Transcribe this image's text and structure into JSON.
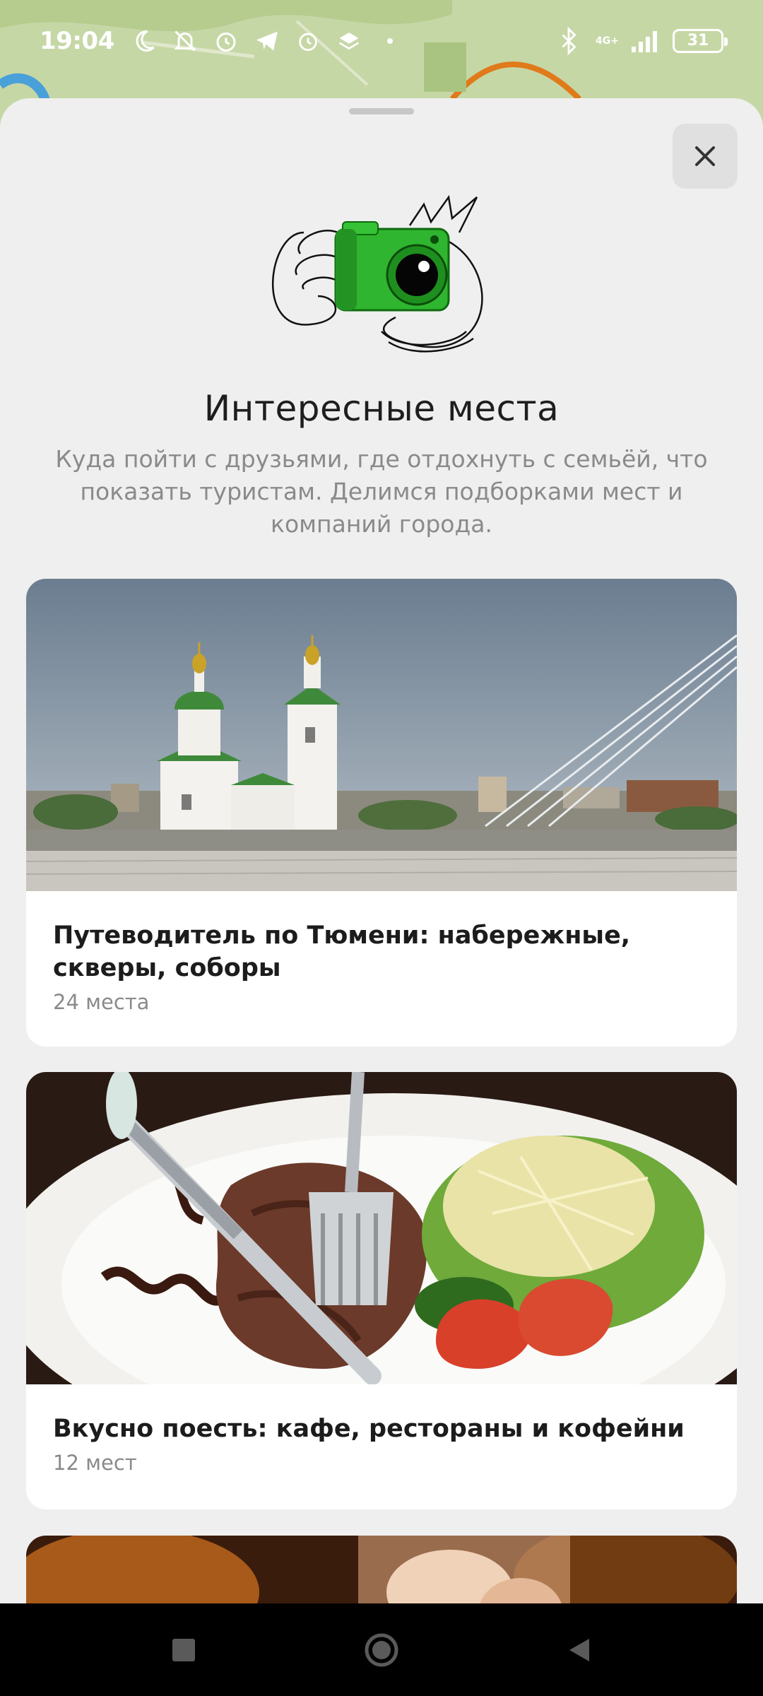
{
  "status_bar": {
    "time": "19:04",
    "network": "4G+",
    "battery": "31"
  },
  "sheet": {
    "title": "Интересные места",
    "description": "Куда пойти с друзьями, где отдохнуть с семьёй, что показать туристам. Делимся подборками мест и компаний города.",
    "close_icon": "close-icon",
    "illustration_icon": "camera-illustration"
  },
  "cards": [
    {
      "title": "Путеводитель по Тюмени: набережные, скверы, соборы",
      "count": "24 места",
      "image": "photo-church-embankment"
    },
    {
      "title": "Вкусно поесть:  кафе, рестораны и кофейни",
      "count": "12 мест",
      "image": "photo-steak-salad"
    },
    {
      "image": "photo-drink"
    }
  ],
  "colors": {
    "sheet_bg": "#efefef",
    "card_bg": "#ffffff",
    "title": "#1e1e1e",
    "muted_text": "#8a8a8a",
    "accent_green": "#2fb52f"
  },
  "nav_bar": {
    "recents_icon": "square-icon",
    "home_icon": "circle-icon",
    "back_icon": "triangle-back-icon"
  }
}
